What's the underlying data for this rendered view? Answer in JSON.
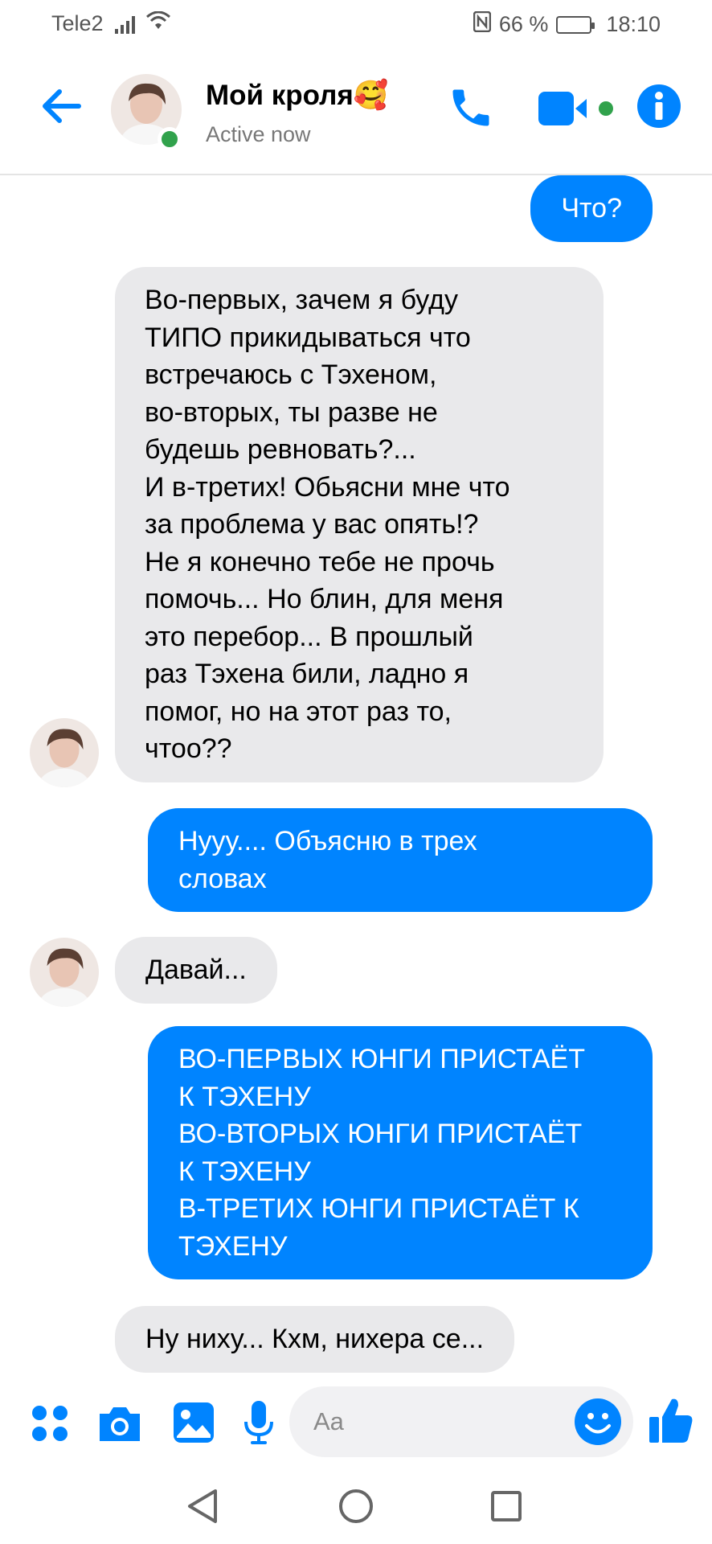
{
  "status_bar": {
    "carrier": "Tele2",
    "battery": "66 %",
    "battery_level": 0.66,
    "time": "18:10",
    "icons": [
      "signal-icon",
      "wifi-icon",
      "nfc-icon",
      "battery-icon"
    ]
  },
  "header": {
    "contact_name": "Мой кроля🥰",
    "status": "Active now",
    "icons": [
      "back-arrow-icon",
      "phone-icon",
      "video-camera-icon",
      "info-icon"
    ],
    "accent_color": "#0084ff",
    "online_color": "#31a24c"
  },
  "messages": [
    {
      "dir": "out",
      "lines": [
        "Что?"
      ]
    },
    {
      "dir": "in",
      "lines": [
        "Во-первых, зачем я буду",
        "ТИПО прикидываться что",
        "встречаюсь с Тэхеном,",
        "во-вторых, ты разве не",
        "будешь ревновать?...",
        "И в-третих! Обьясни мне что",
        "за проблема у вас опять!?",
        "Не я конечно тебе не прочь",
        "помочь... Но блин, для меня",
        "это перебор... В прошлый",
        "раз Тэхена били, ладно я",
        "помог, но на этот раз то,",
        "чтоо??"
      ]
    },
    {
      "dir": "out",
      "lines": [
        "Нууу.... Объясню в трех",
        "словах"
      ]
    },
    {
      "dir": "in",
      "lines": [
        "Давай..."
      ]
    },
    {
      "dir": "out",
      "lines": [
        "ВО-ПЕРВЫХ ЮНГИ ПРИСТАЁТ",
        "К ТЭХЕНУ",
        "ВО-ВТОРЫХ ЮНГИ ПРИСТАЁТ",
        "К ТЭХЕНУ",
        "В-ТРЕТИХ ЮНГИ ПРИСТАЁТ К",
        "ТЭХЕНУ"
      ]
    },
    {
      "dir": "in",
      "lines": [
        "Ну ниху... Кхм, нихера се..."
      ]
    }
  ],
  "composer": {
    "placeholder": "Aa",
    "icons": [
      "apps-icon",
      "camera-icon",
      "gallery-icon",
      "microphone-icon",
      "emoji-icon",
      "like-icon"
    ]
  },
  "nav_bar": {
    "icons": [
      "nav-back-icon",
      "nav-home-icon",
      "nav-recents-icon"
    ]
  }
}
